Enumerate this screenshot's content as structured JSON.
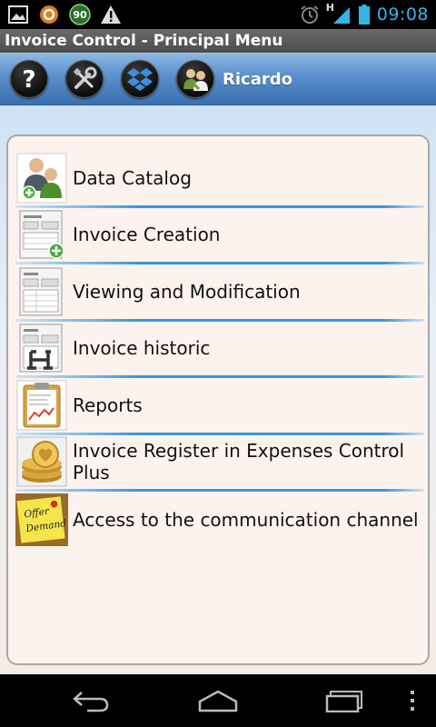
{
  "status_bar": {
    "time": "09:08",
    "network_type": "H",
    "notification_badge": "90",
    "icons": [
      "image-icon",
      "sync-icon",
      "badge-90-icon",
      "warning-icon",
      "alarm-icon",
      "signal-icon",
      "battery-icon"
    ],
    "time_color": "#33b5e5"
  },
  "app": {
    "title": "Invoice Control - Principal Menu"
  },
  "toolbar": {
    "buttons": [
      "help-icon",
      "tools-icon",
      "dropbox-icon",
      "users-icon"
    ],
    "user_name": "Ricardo"
  },
  "menu": {
    "items": [
      {
        "label": "Data Catalog",
        "icon": "users-add-icon"
      },
      {
        "label": "Invoice Creation",
        "icon": "invoice-add-icon"
      },
      {
        "label": "Viewing and Modification",
        "icon": "invoice-view-icon"
      },
      {
        "label": "Invoice historic",
        "icon": "invoice-history-icon"
      },
      {
        "label": "Reports",
        "icon": "report-clipboard-icon"
      },
      {
        "label": "Invoice Register in Expenses Control Plus",
        "icon": "coins-icon"
      },
      {
        "label": "Access to the communication channel",
        "icon": "sticky-note-icon",
        "note_text": [
          "Offer",
          "Demand"
        ]
      }
    ],
    "divider_color": "#3a96dd"
  },
  "nav_bar": {
    "buttons": [
      "back-icon",
      "home-icon",
      "recent-apps-icon",
      "overflow-menu-icon"
    ]
  }
}
